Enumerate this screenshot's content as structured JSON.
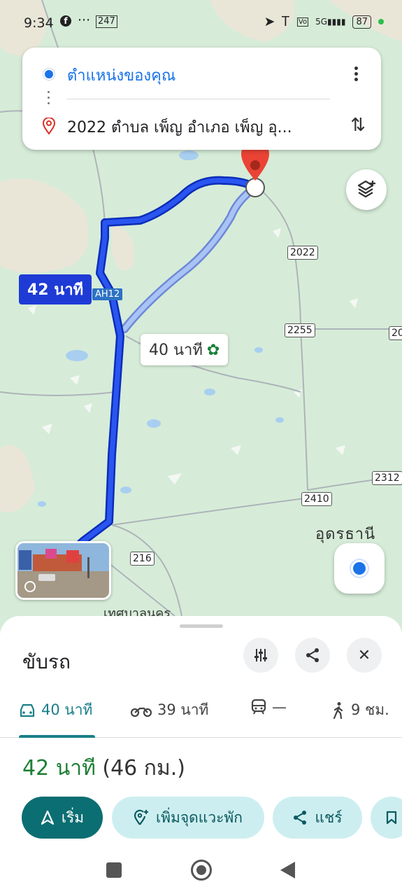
{
  "status_bar": {
    "time": "9:34",
    "notif_icons": [
      "facebook-icon",
      "more-icon"
    ],
    "notif_badge": "247",
    "battery": "87",
    "system_icons": [
      "location-arrow-icon",
      "bluetooth-icon",
      "volte-icon",
      "signal-5g-icon",
      "battery-icon"
    ]
  },
  "route_card": {
    "origin": "ตำแหน่งของคุณ",
    "destination": "2022 ตำบล เพ็ญ อำเภอ เพ็ญ อุ...",
    "more_icon": "more-vert-icon",
    "swap_icon": "swap-vert-icon"
  },
  "map": {
    "route_label_main": "42 นาที",
    "route_label_alt": "40 นาที",
    "highway_label": "AH12",
    "road_shields": [
      "2022",
      "2255",
      "20",
      "2312",
      "2410",
      "216"
    ],
    "city_label": "อุดรธานี",
    "town_label": "เทศบาลนคร",
    "layers_icon": "layers-add-icon",
    "locate_icon": "my-location-icon",
    "colors": {
      "route_main": "#1e3bd6",
      "route_alt": "#9bb7f0",
      "pin": "#ea4335"
    }
  },
  "sheet": {
    "title": "ขับรถ",
    "buttons": [
      "tune-icon",
      "share-icon",
      "close-icon"
    ],
    "modes": [
      {
        "icon": "car-icon",
        "label": "40 นาที",
        "active": true
      },
      {
        "icon": "motorcycle-icon",
        "label": "39 นาที",
        "active": false
      },
      {
        "icon": "train-icon",
        "label": "—",
        "active": false
      },
      {
        "icon": "walk-icon",
        "label": "9 ชม.",
        "active": false
      }
    ],
    "summary": {
      "duration": "42 นาที",
      "distance": "(46 กม.)"
    },
    "actions": {
      "start": "เริ่ม",
      "add_stop": "เพิ่มจุดแวะพัก",
      "share": "แชร์"
    },
    "accent_color": "#0b6e72"
  }
}
